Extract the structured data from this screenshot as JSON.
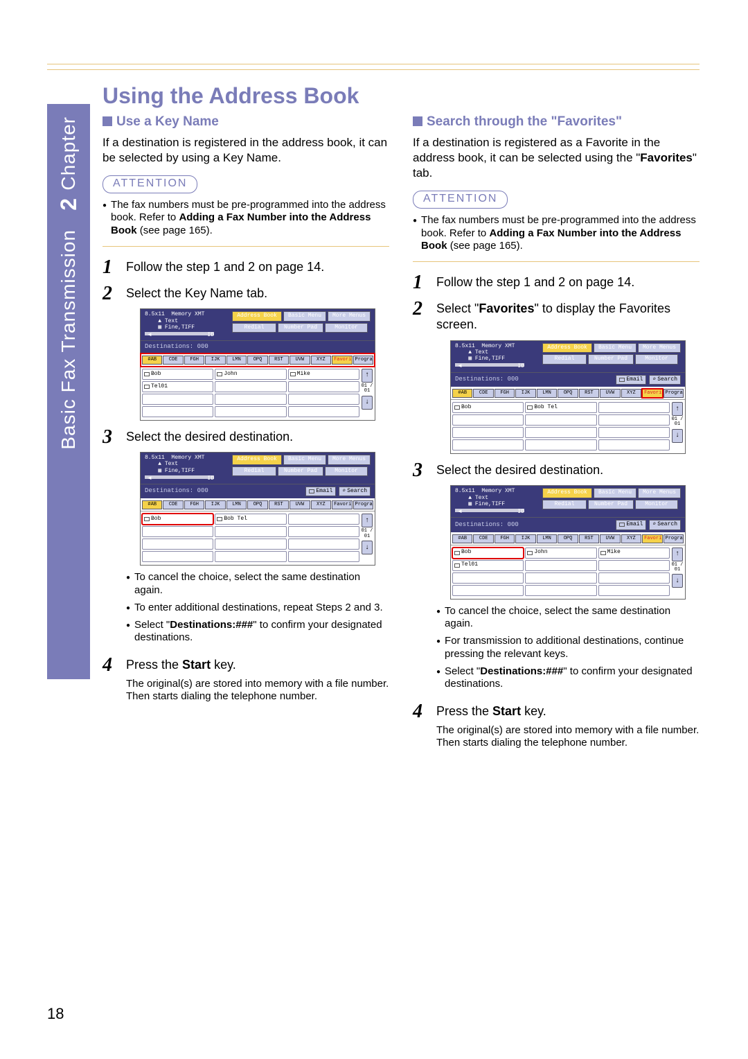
{
  "chapter_label": "Chapter",
  "chapter_number": "2",
  "chapter_section": "Basic Fax Transmission",
  "page_title": "Using the Address Book",
  "page_number": "18",
  "common": {
    "attention_label": "ATTENTION",
    "attention_note_prefix": "The fax numbers must be pre-programmed into the address book. Refer to ",
    "attention_note_bold": "Adding a Fax Number into the Address Book",
    "attention_note_suffix": " (see page 165).",
    "step1": "Follow the step 1 and 2 on page 14.",
    "step3": "Select the desired destination.",
    "bullet_cancel": "To cancel the choice, select the same destination again.",
    "bullet_confirm_prefix": "Select \"",
    "bullet_confirm_bold": "Destinations:###",
    "bullet_confirm_suffix": "\" to confirm your designated destinations.",
    "step4_prefix": "Press the ",
    "step4_bold": "Start",
    "step4_suffix": " key.",
    "step4_note": "The original(s) are stored into memory with a file number. Then starts dialing the telephone number."
  },
  "left": {
    "heading": "Use a Key Name",
    "intro": "If a destination is registered in the address book, it can be selected by using a Key Name.",
    "step2": "Select the Key Name tab.",
    "bullet_repeat": "To enter additional destinations, repeat Steps 2 and 3."
  },
  "right": {
    "heading": "Search through the \"Favorites\"",
    "intro_prefix": "If a destination is registered as a Favorite in the address book, it can be selected using the \"",
    "intro_bold": "Favorites",
    "intro_suffix": "\" tab.",
    "step2_prefix": "Select \"",
    "step2_bold": "Favorites",
    "step2_suffix": "\" to display the Favorites screen.",
    "bullet_additional": "For transmission to additional destinations, continue pressing the relevant keys."
  },
  "screen": {
    "size": "8.5x11",
    "mode": "Memory XMT",
    "opt1": "Text",
    "opt2": "Fine,TIFF",
    "id": "ID",
    "btn_address": "Address Book",
    "btn_basic": "Basic Menu",
    "btn_more": "More Menus",
    "btn_redial": "Redial",
    "btn_numpad": "Number Pad",
    "btn_monitor": "Monitor",
    "destinations": "Destinations: 000",
    "btn_email": "Email",
    "btn_search": "Search",
    "tabs": [
      "#AB",
      "CDE",
      "FGH",
      "IJK",
      "LMN",
      "OPQ",
      "RST",
      "UVW",
      "XYZ",
      "Favorites",
      "Program/Group"
    ],
    "entry_bob": "Bob",
    "entry_john": "John",
    "entry_mike": "Mike",
    "entry_tel01": "Tel01",
    "entry_bobtel": "Bob Tel",
    "page_ind": "01 / 01",
    "arrow_up": "↑",
    "arrow_down": "↓"
  }
}
